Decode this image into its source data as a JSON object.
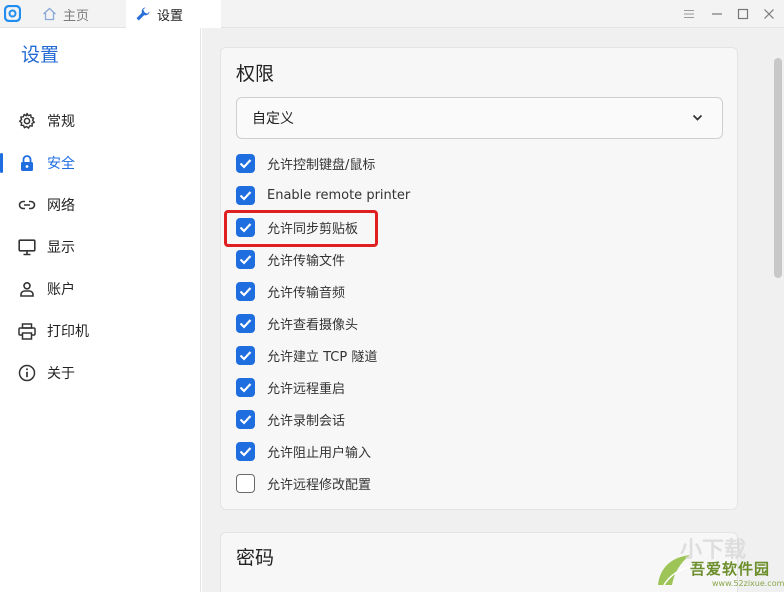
{
  "titlebar": {
    "tabs": [
      {
        "label": "主页",
        "icon": "home-icon",
        "active": false
      },
      {
        "label": "设置",
        "icon": "wrench-icon",
        "active": true
      }
    ],
    "controls": [
      "menu-icon",
      "minimize-icon",
      "maximize-icon",
      "close-icon"
    ]
  },
  "sidebar": {
    "title": "设置",
    "items": [
      {
        "label": "常规",
        "icon": "gear-icon",
        "active": false
      },
      {
        "label": "安全",
        "icon": "lock-icon",
        "active": true
      },
      {
        "label": "网络",
        "icon": "link-icon",
        "active": false
      },
      {
        "label": "显示",
        "icon": "monitor-icon",
        "active": false
      },
      {
        "label": "账户",
        "icon": "user-icon",
        "active": false
      },
      {
        "label": "打印机",
        "icon": "printer-icon",
        "active": false
      },
      {
        "label": "关于",
        "icon": "info-icon",
        "active": false
      }
    ]
  },
  "main": {
    "permissions": {
      "title": "权限",
      "mode_select": {
        "value": "自定义"
      },
      "options": [
        {
          "label": "允许控制键盘/鼠标",
          "checked": true
        },
        {
          "label": "Enable remote printer",
          "checked": true
        },
        {
          "label": "允许同步剪贴板",
          "checked": true,
          "highlighted": true
        },
        {
          "label": "允许传输文件",
          "checked": true
        },
        {
          "label": "允许传输音频",
          "checked": true
        },
        {
          "label": "允许查看摄像头",
          "checked": true
        },
        {
          "label": "允许建立 TCP 隧道",
          "checked": true
        },
        {
          "label": "允许远程重启",
          "checked": true
        },
        {
          "label": "允许录制会话",
          "checked": true
        },
        {
          "label": "允许阻止用户输入",
          "checked": true
        },
        {
          "label": "允许远程修改配置",
          "checked": false
        }
      ]
    },
    "password": {
      "title": "密码"
    }
  },
  "watermark": {
    "text": "吾爱软件园",
    "url": "www.52zixue.com"
  },
  "colors": {
    "accent": "#1f6ee0",
    "highlight": "#e02020",
    "background": "#f0f0f0"
  }
}
